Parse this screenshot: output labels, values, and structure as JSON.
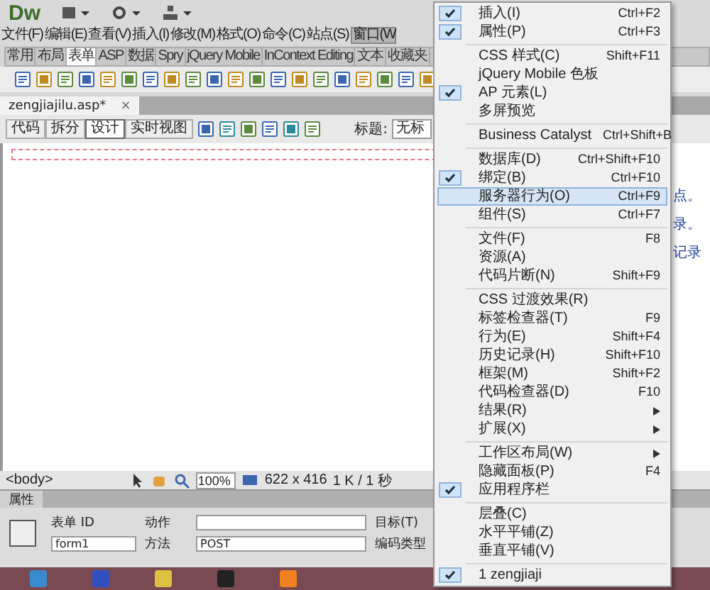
{
  "app_bar": {
    "logo": "Dw"
  },
  "menu_bar": [
    {
      "label": "文件(F)",
      "selected": false
    },
    {
      "label": "编辑(E)",
      "selected": false
    },
    {
      "label": "查看(V)",
      "selected": false
    },
    {
      "label": "插入(I)",
      "selected": false
    },
    {
      "label": "修改(M)",
      "selected": false
    },
    {
      "label": "格式(O)",
      "selected": false
    },
    {
      "label": "命令(C)",
      "selected": false
    },
    {
      "label": "站点(S)",
      "selected": false
    },
    {
      "label": "窗口(W",
      "selected": true
    }
  ],
  "insert_tabs": [
    {
      "label": "常用",
      "selected": false
    },
    {
      "label": "布局",
      "selected": false
    },
    {
      "label": "表单",
      "selected": true
    },
    {
      "label": "ASP",
      "selected": false
    },
    {
      "label": "数据",
      "selected": false
    },
    {
      "label": "Spry",
      "selected": false
    },
    {
      "label": "jQuery Mobile",
      "selected": false
    },
    {
      "label": "InContext Editing",
      "selected": false
    },
    {
      "label": "文本",
      "selected": false
    },
    {
      "label": "收藏夹",
      "selected": false
    }
  ],
  "document_tab": {
    "label": "zengjiajilu.asp*",
    "close": "×"
  },
  "view_buttons": [
    {
      "label": "代码",
      "selected": false
    },
    {
      "label": "拆分",
      "selected": false
    },
    {
      "label": "设计",
      "selected": true
    },
    {
      "label": "实时视图",
      "selected": false
    }
  ],
  "title_field": {
    "label": "标题:",
    "value": "无标"
  },
  "side_panel": {
    "lines": [
      "点。",
      "录。",
      "记录"
    ]
  },
  "status_bar": {
    "tag": "<body>",
    "zoom": "100%",
    "size": "622 x 416",
    "download": "1 K / 1 秒"
  },
  "properties": {
    "tab": "属性",
    "form_id_label": "表单 ID",
    "form_id": "form1",
    "action_label": "动作",
    "method_label": "方法",
    "method": "POST",
    "target_label": "目标(T)",
    "enctype_label": "编码类型"
  },
  "window_menu": [
    {
      "kind": "item",
      "label": "插入(I)",
      "shortcut": "Ctrl+F2",
      "checked": true,
      "selected": false,
      "submenu": false
    },
    {
      "kind": "item",
      "label": "属性(P)",
      "shortcut": "Ctrl+F3",
      "checked": true,
      "selected": false,
      "submenu": false
    },
    {
      "kind": "separator"
    },
    {
      "kind": "item",
      "label": "CSS 样式(C)",
      "shortcut": "Shift+F11",
      "checked": false,
      "selected": false,
      "submenu": false
    },
    {
      "kind": "item",
      "label": "jQuery Mobile 色板",
      "checked": false,
      "selected": false,
      "submenu": false
    },
    {
      "kind": "item",
      "label": "AP 元素(L)",
      "checked": true,
      "selected": false,
      "submenu": false
    },
    {
      "kind": "item",
      "label": "多屏预览",
      "checked": false,
      "selected": false,
      "submenu": false
    },
    {
      "kind": "separator"
    },
    {
      "kind": "item",
      "label": "Business Catalyst",
      "shortcut": "Ctrl+Shift+B",
      "checked": false,
      "selected": false,
      "submenu": false
    },
    {
      "kind": "separator"
    },
    {
      "kind": "item",
      "label": "数据库(D)",
      "shortcut": "Ctrl+Shift+F10",
      "checked": false,
      "selected": false,
      "submenu": false
    },
    {
      "kind": "item",
      "label": "绑定(B)",
      "shortcut": "Ctrl+F10",
      "checked": true,
      "selected": false,
      "submenu": false
    },
    {
      "kind": "item",
      "label": "服务器行为(O)",
      "shortcut": "Ctrl+F9",
      "checked": false,
      "selected": true,
      "submenu": false
    },
    {
      "kind": "item",
      "label": "组件(S)",
      "shortcut": "Ctrl+F7",
      "checked": false,
      "selected": false,
      "submenu": false
    },
    {
      "kind": "separator"
    },
    {
      "kind": "item",
      "label": "文件(F)",
      "shortcut": "F8",
      "checked": false,
      "selected": false,
      "submenu": false
    },
    {
      "kind": "item",
      "label": "资源(A)",
      "checked": false,
      "selected": false,
      "submenu": false
    },
    {
      "kind": "item",
      "label": "代码片断(N)",
      "shortcut": "Shift+F9",
      "checked": false,
      "selected": false,
      "submenu": false
    },
    {
      "kind": "separator"
    },
    {
      "kind": "item",
      "label": "CSS 过渡效果(R)",
      "checked": false,
      "selected": false,
      "submenu": false
    },
    {
      "kind": "item",
      "label": "标签检查器(T)",
      "shortcut": "F9",
      "checked": false,
      "selected": false,
      "submenu": false
    },
    {
      "kind": "item",
      "label": "行为(E)",
      "shortcut": "Shift+F4",
      "checked": false,
      "selected": false,
      "submenu": false
    },
    {
      "kind": "item",
      "label": "历史记录(H)",
      "shortcut": "Shift+F10",
      "checked": false,
      "selected": false,
      "submenu": false
    },
    {
      "kind": "item",
      "label": "框架(M)",
      "shortcut": "Shift+F2",
      "checked": false,
      "selected": false,
      "submenu": false
    },
    {
      "kind": "item",
      "label": "代码检查器(D)",
      "shortcut": "F10",
      "checked": false,
      "selected": false,
      "submenu": false
    },
    {
      "kind": "item",
      "label": "结果(R)",
      "checked": false,
      "selected": false,
      "submenu": true
    },
    {
      "kind": "item",
      "label": "扩展(X)",
      "checked": false,
      "selected": false,
      "submenu": true
    },
    {
      "kind": "separator"
    },
    {
      "kind": "item",
      "label": "工作区布局(W)",
      "checked": false,
      "selected": false,
      "submenu": true
    },
    {
      "kind": "item",
      "label": "隐藏面板(P)",
      "shortcut": "F4",
      "checked": false,
      "selected": false,
      "submenu": false
    },
    {
      "kind": "item",
      "label": "应用程序栏",
      "checked": true,
      "selected": false,
      "submenu": false
    },
    {
      "kind": "separator"
    },
    {
      "kind": "item",
      "label": "层叠(C)",
      "checked": false,
      "selected": false,
      "submenu": false
    },
    {
      "kind": "item",
      "label": "水平平铺(Z)",
      "checked": false,
      "selected": false,
      "submenu": false
    },
    {
      "kind": "item",
      "label": "垂直平铺(V)",
      "checked": false,
      "selected": false,
      "submenu": false
    },
    {
      "kind": "separator"
    },
    {
      "kind": "item",
      "label": "1 zengjiaji",
      "checked": true,
      "selected": false,
      "submenu": false
    }
  ]
}
